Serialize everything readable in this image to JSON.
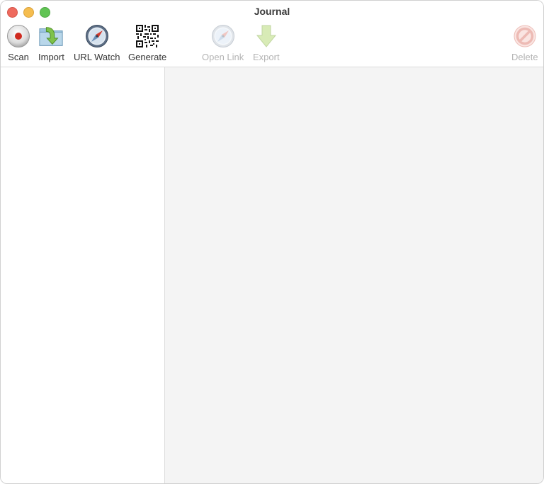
{
  "window": {
    "title": "Journal"
  },
  "toolbar": {
    "scan": {
      "label": "Scan",
      "icon": "record-icon",
      "enabled": true
    },
    "import": {
      "label": "Import",
      "icon": "folder-import-icon",
      "enabled": true
    },
    "url_watch": {
      "label": "URL Watch",
      "icon": "compass-icon",
      "enabled": true
    },
    "generate": {
      "label": "Generate",
      "icon": "qr-code-icon",
      "enabled": true
    },
    "open_link": {
      "label": "Open Link",
      "icon": "compass-icon",
      "enabled": false
    },
    "export": {
      "label": "Export",
      "icon": "arrow-down-icon",
      "enabled": false
    },
    "delete": {
      "label": "Delete",
      "icon": "prohibited-icon",
      "enabled": false
    }
  },
  "colors": {
    "close": "#ee6a5e",
    "minimize": "#f5bd4f",
    "maximize": "#61c454",
    "detail_background": "#f4f4f4",
    "disabled_label": "#b4b4b4"
  }
}
